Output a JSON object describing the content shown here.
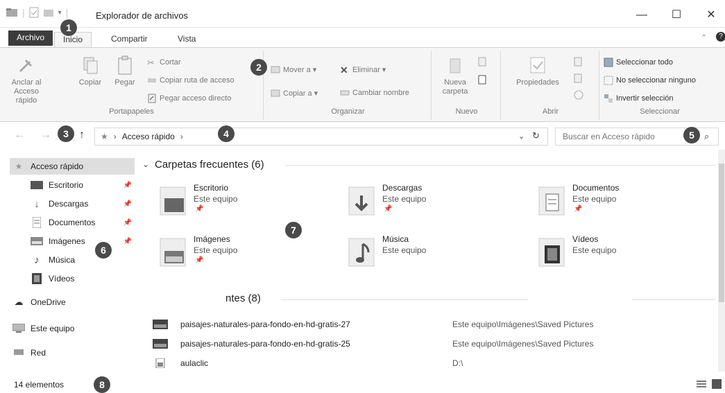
{
  "window": {
    "title": "Explorador de archivos",
    "controls": {
      "minimize": "—",
      "maximize": "☐",
      "close": "✕"
    }
  },
  "tabs": [
    {
      "label": "Archivo"
    },
    {
      "label": "Inicio"
    },
    {
      "label": "Compartir"
    },
    {
      "label": "Vista"
    }
  ],
  "ribbon": {
    "portapapeles": {
      "label": "Portapapeles",
      "anclar": "Anclar al Acceso rápido",
      "copiar": "Copiar",
      "pegar": "Pegar",
      "cortar": "Cortar",
      "copiar_ruta": "Copiar ruta de acceso",
      "pegar_acceso": "Pegar acceso directo"
    },
    "organizar": {
      "label": "Organizar",
      "mover": "Mover a ▾",
      "copiar": "Copiar a ▾",
      "eliminar": "Eliminar ▾",
      "cambiar": "Cambiar nombre"
    },
    "nuevo": {
      "label": "Nuevo",
      "nueva_carpeta": "Nueva carpeta"
    },
    "abrir": {
      "label": "Abrir",
      "propiedades": "Propiedades"
    },
    "seleccionar": {
      "label": "Seleccionar",
      "todo": "Seleccionar todo",
      "ninguno": "No seleccionar ninguno",
      "invertir": "Invertir selección"
    }
  },
  "address": {
    "crumb": "Acceso rápido",
    "search_placeholder": "Buscar en Acceso rápido"
  },
  "sidebar": {
    "items": [
      {
        "label": "Acceso rápido"
      },
      {
        "label": "Escritorio"
      },
      {
        "label": "Descargas"
      },
      {
        "label": "Documentos"
      },
      {
        "label": "Imágenes"
      },
      {
        "label": "Música"
      },
      {
        "label": "Vídeos"
      },
      {
        "label": "OneDrive"
      },
      {
        "label": "Este equipo"
      },
      {
        "label": "Red"
      }
    ]
  },
  "main": {
    "frequent_header": "Carpetas frecuentes (6)",
    "recent_header": "ntes (8)",
    "folders": [
      {
        "name": "Escritorio",
        "location": "Este equipo"
      },
      {
        "name": "Descargas",
        "location": "Este equipo"
      },
      {
        "name": "Documentos",
        "location": "Este equipo"
      },
      {
        "name": "Imágenes",
        "location": "Este equipo"
      },
      {
        "name": "Música",
        "location": "Este equipo"
      },
      {
        "name": "Vídeos",
        "location": "Este equipo"
      }
    ],
    "recent": [
      {
        "name": "paisajes-naturales-para-fondo-en-hd-gratis-27",
        "path": "Este equipo\\Imágenes\\Saved Pictures"
      },
      {
        "name": "paisajes-naturales-para-fondo-en-hd-gratis-25",
        "path": "Este equipo\\Imágenes\\Saved Pictures"
      },
      {
        "name": "aulaclic",
        "path": "D:\\"
      }
    ]
  },
  "status": {
    "count": "14 elementos"
  },
  "callouts": [
    "1",
    "2",
    "3",
    "4",
    "5",
    "6",
    "7",
    "8"
  ]
}
